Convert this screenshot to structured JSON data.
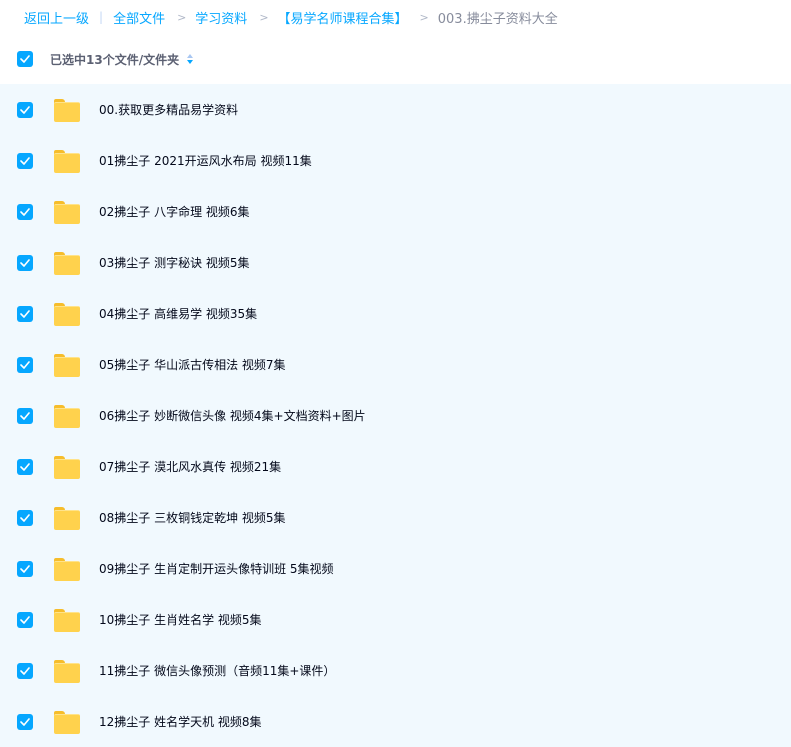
{
  "breadcrumb": {
    "back": "返回上一级",
    "all_files": "全部文件",
    "level1": "学习资料",
    "level2": "【易学名师课程合集】",
    "current": "003.拂尘子资料大全",
    "separator": "|",
    "arrow": ">"
  },
  "selection": {
    "label": "已选中13个文件/文件夹"
  },
  "files": [
    {
      "name": "00.获取更多精品易学资料",
      "checked": true
    },
    {
      "name": "01拂尘子 2021开运风水布局 视频11集",
      "checked": true
    },
    {
      "name": "02拂尘子 八字命理 视频6集",
      "checked": true
    },
    {
      "name": "03拂尘子 测字秘诀 视频5集",
      "checked": true
    },
    {
      "name": "04拂尘子 高维易学 视频35集",
      "checked": true
    },
    {
      "name": "05拂尘子 华山派古传相法 视频7集",
      "checked": true
    },
    {
      "name": "06拂尘子 妙断微信头像 视频4集+文档资料+图片",
      "checked": true
    },
    {
      "name": "07拂尘子 漠北风水真传 视频21集",
      "checked": true
    },
    {
      "name": "08拂尘子 三枚铜钱定乾坤 视频5集",
      "checked": true
    },
    {
      "name": "09拂尘子 生肖定制开运头像特训班 5集视频",
      "checked": true
    },
    {
      "name": "10拂尘子 生肖姓名学 视频5集",
      "checked": true
    },
    {
      "name": "11拂尘子 微信头像预测（音频11集+课件）",
      "checked": true
    },
    {
      "name": "12拂尘子 姓名学天机 视频8集",
      "checked": true
    }
  ],
  "colors": {
    "accent": "#06a7ff",
    "list_bg": "#f1f9fe",
    "folder": "#ffd24d"
  }
}
